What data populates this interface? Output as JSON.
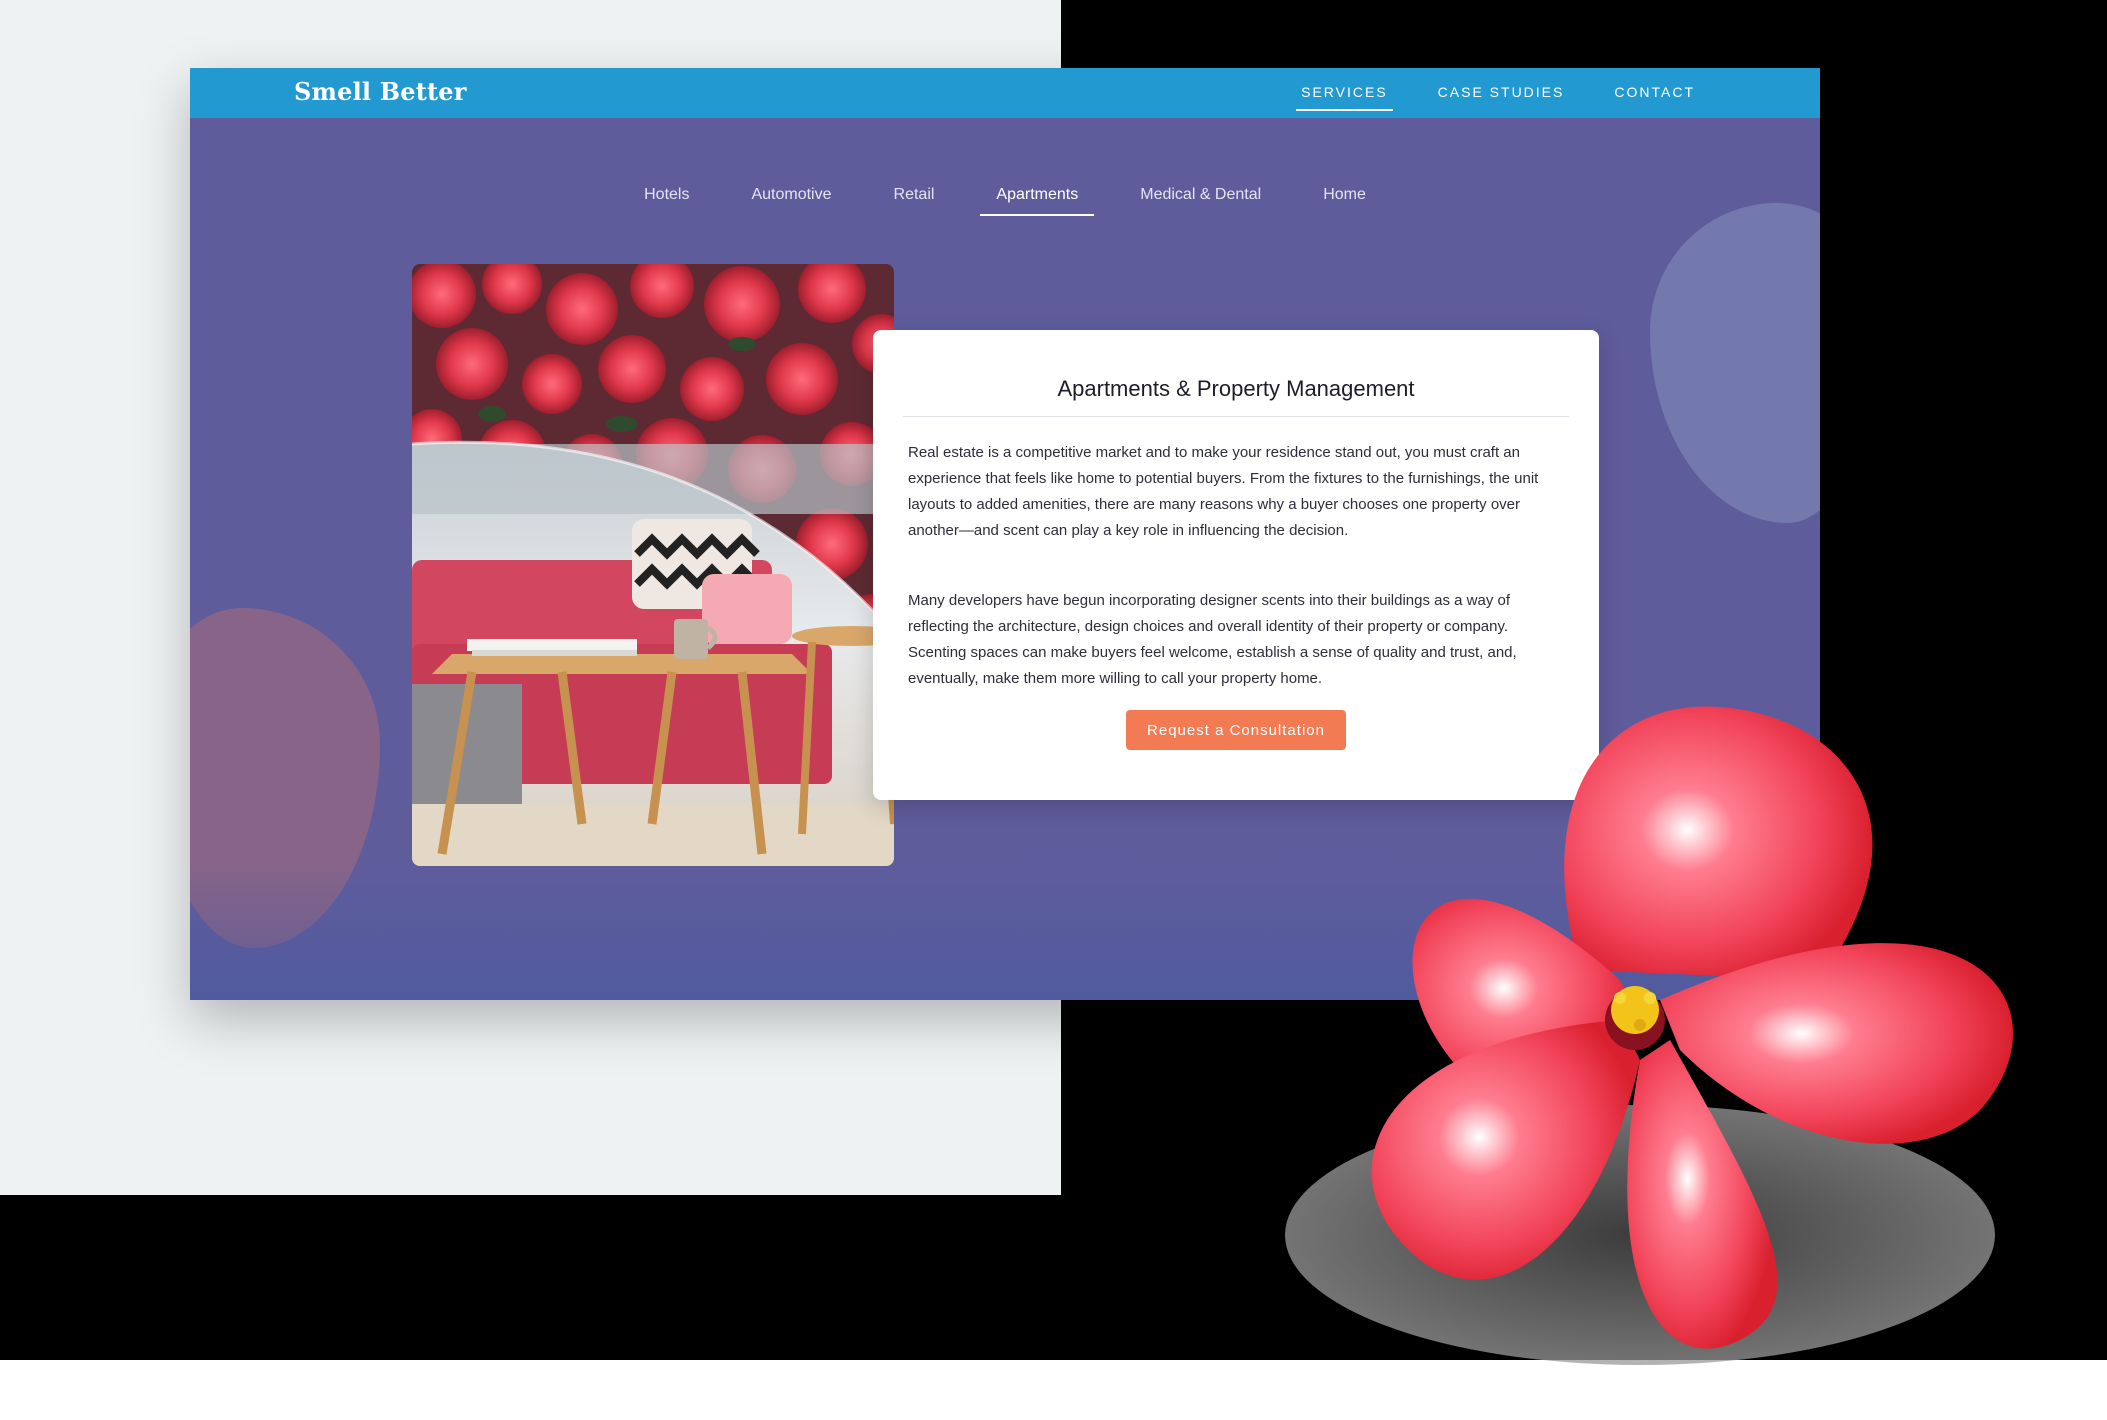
{
  "brand": {
    "name": "Smell Better"
  },
  "top_nav": {
    "items": [
      {
        "label": "SERVICES",
        "active": true
      },
      {
        "label": "CASE STUDIES",
        "active": false
      },
      {
        "label": "CONTACT",
        "active": false
      }
    ]
  },
  "sub_nav": {
    "items": [
      {
        "label": "Hotels",
        "active": false
      },
      {
        "label": "Automotive",
        "active": false
      },
      {
        "label": "Retail",
        "active": false
      },
      {
        "label": "Apartments",
        "active": true
      },
      {
        "label": "Medical & Dental",
        "active": false
      },
      {
        "label": "Home",
        "active": false
      }
    ]
  },
  "card": {
    "title": "Apartments & Property Management",
    "paragraph_1": "Real estate is a competitive market and to make your residence stand out, you must craft an experience that feels like home to potential buyers. From the fixtures to the furnishings, the unit layouts to added amenities, there are many reasons why a buyer chooses one property over another—and scent can play a key role in influencing the decision.",
    "paragraph_2": "Many developers have begun incorporating designer scents into their buildings as a way of reflecting the architecture, design choices and overall identity of their property or company. Scenting spaces can make buyers feel welcome, establish a sense of quality and trust, and, eventually, make them more willing to call your property home.",
    "cta_label": "Request a Consultation"
  },
  "colors": {
    "topbar": "#2399d1",
    "page_background": "#5f5c9c",
    "cta": "#f27b54",
    "flower": "#f04a5e"
  }
}
